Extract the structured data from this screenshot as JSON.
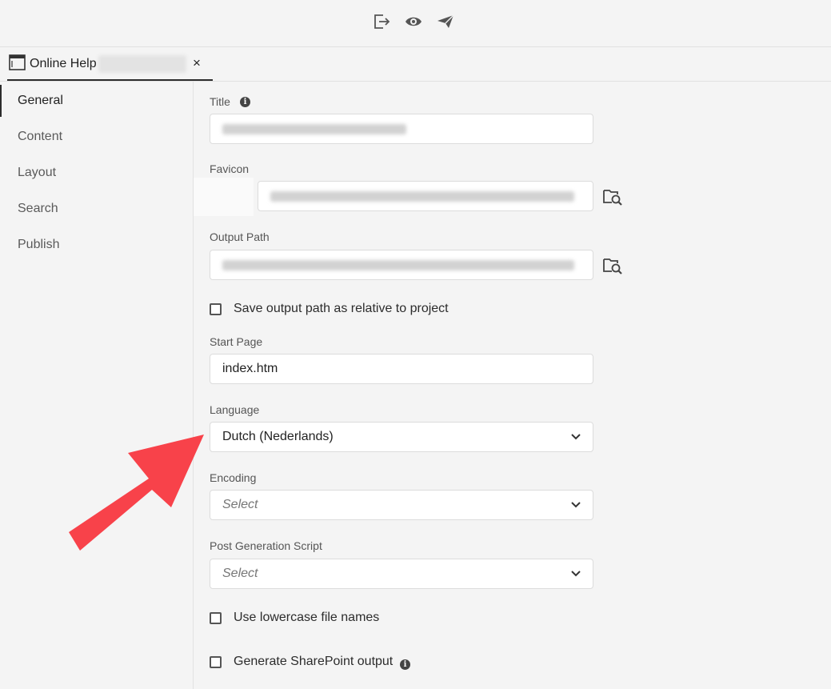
{
  "toolbar": {
    "icons": [
      "export-icon",
      "preview-icon",
      "publish-send-icon"
    ]
  },
  "tab": {
    "title": "Online Help",
    "close": "×"
  },
  "sidebar": {
    "items": [
      {
        "label": "General",
        "active": true
      },
      {
        "label": "Content",
        "active": false
      },
      {
        "label": "Layout",
        "active": false
      },
      {
        "label": "Search",
        "active": false
      },
      {
        "label": "Publish",
        "active": false
      }
    ]
  },
  "form": {
    "title_label": "Title",
    "favicon_label": "Favicon",
    "output_path_label": "Output Path",
    "relative_path_checkbox": {
      "label": "Save output path as relative to project",
      "checked": false
    },
    "start_page_label": "Start Page",
    "start_page_value": "index.htm",
    "language_label": "Language",
    "language_value": "Dutch (Nederlands)",
    "encoding_label": "Encoding",
    "encoding_placeholder": "Select",
    "post_script_label": "Post Generation Script",
    "post_script_placeholder": "Select",
    "lowercase_checkbox": {
      "label": "Use lowercase file names",
      "checked": false
    },
    "sharepoint_checkbox": {
      "label": "Generate SharePoint output",
      "checked": false
    },
    "info_glyph": "i"
  },
  "colors": {
    "annotation_arrow": "#f8424a",
    "accent_text": "#2c2c2c"
  }
}
